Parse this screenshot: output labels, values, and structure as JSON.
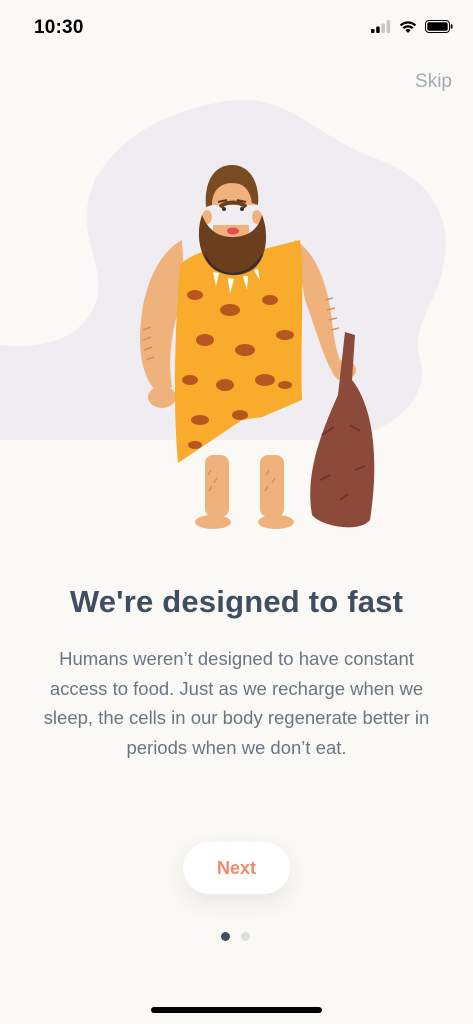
{
  "status_bar": {
    "time": "10:30"
  },
  "header": {
    "skip_label": "Skip"
  },
  "onboarding": {
    "title": "We're designed to fast",
    "body": "Humans weren’t designed to have constant access to food. Just as we recharge when we sleep, the cells in our body regenerate better in periods when we don’t eat.",
    "next_label": "Next",
    "page_indicator": {
      "current": 1,
      "total": 2
    }
  },
  "colors": {
    "background": "#fbf9f5",
    "title": "#3f4e61",
    "body": "#6a7683",
    "accent": "#f08a6e",
    "skip": "#a3aab2"
  },
  "icons": [
    "cellular-signal-icon",
    "wifi-icon",
    "battery-icon"
  ]
}
